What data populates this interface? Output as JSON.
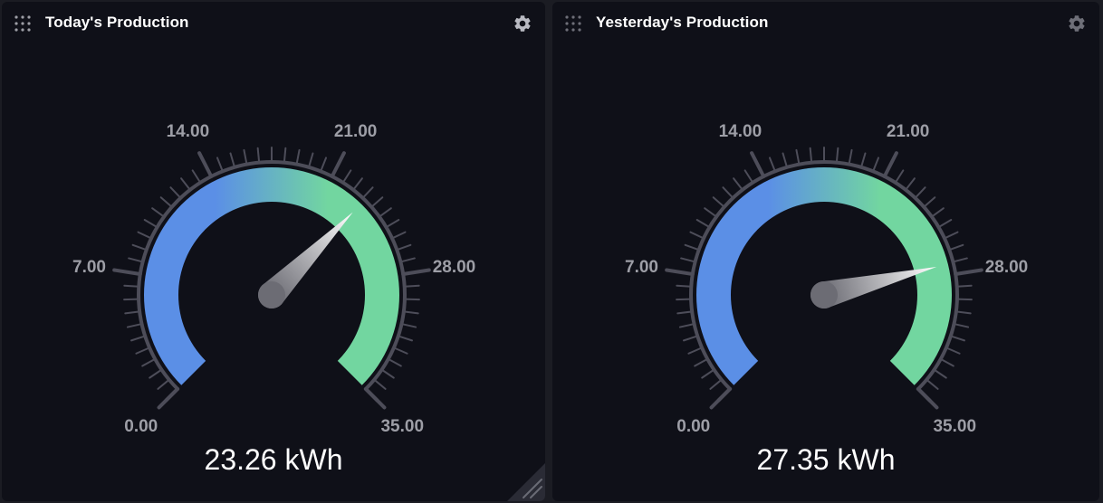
{
  "colors": {
    "background": "#1b1c23",
    "panel": "#0f1018",
    "arc_start": "#5b8fe6",
    "arc_end": "#72d6a0",
    "tick": "#4d4d59",
    "label": "#9d9ea6",
    "text": "#ffffff"
  },
  "icons": {
    "drag": "drag-dots-icon",
    "settings": "gear-icon",
    "resize": "resize-handle-icon"
  },
  "panels": [
    {
      "title": "Today's Production",
      "value": 23.26,
      "value_text": "23.26 kWh",
      "gauge": {
        "min": 0,
        "max": 35,
        "labels": [
          "0.00",
          "7.00",
          "14.00",
          "21.00",
          "28.00",
          "35.00"
        ]
      }
    },
    {
      "title": "Yesterday's Production",
      "value": 27.35,
      "value_text": "27.35 kWh",
      "gauge": {
        "min": 0,
        "max": 35,
        "labels": [
          "0.00",
          "7.00",
          "14.00",
          "21.00",
          "28.00",
          "35.00"
        ]
      }
    }
  ]
}
